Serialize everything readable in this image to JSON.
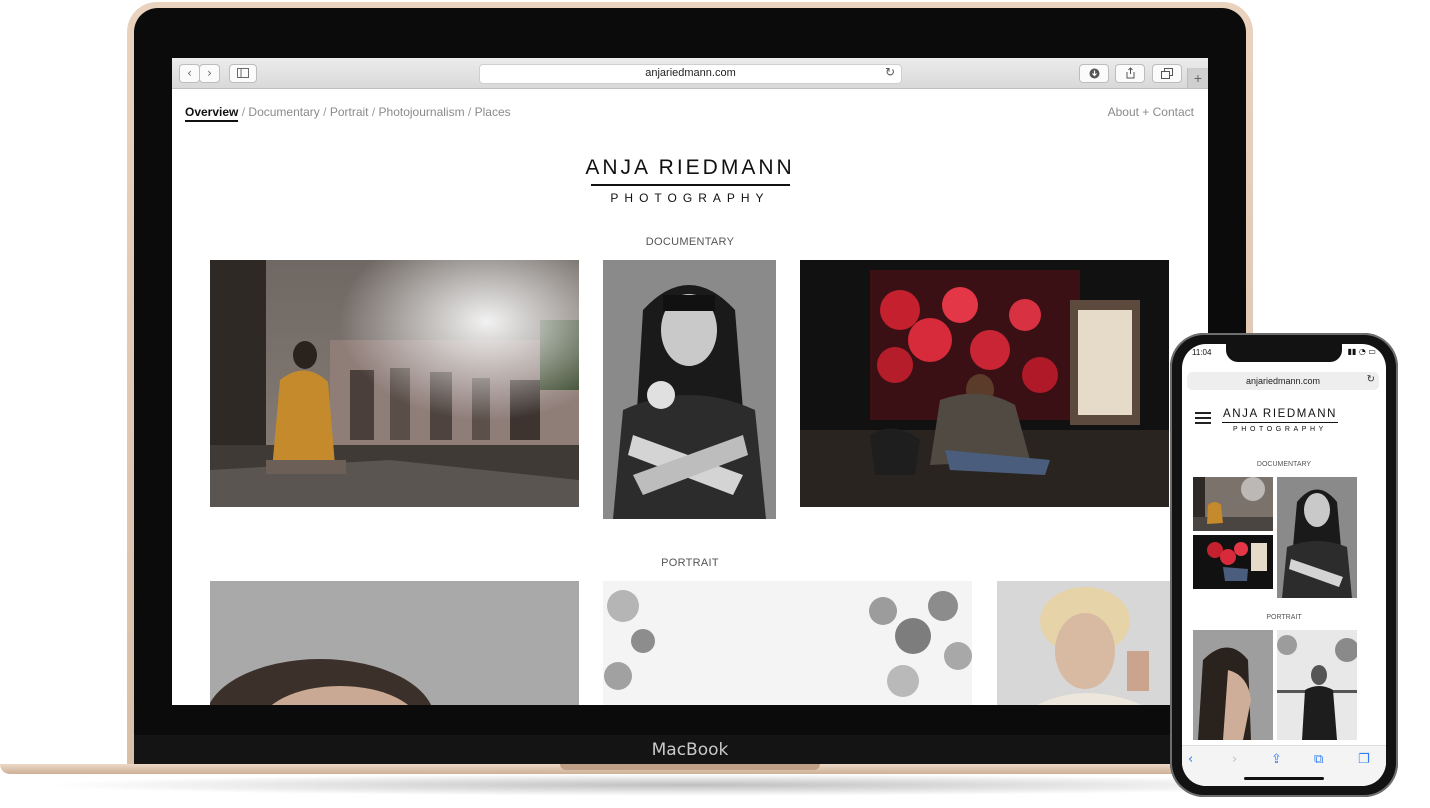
{
  "laptop": {
    "brand": "MacBook"
  },
  "browser": {
    "url": "anjariedmann.com",
    "icons": {
      "back": "chevron-left-icon",
      "forward": "chevron-right-icon",
      "sidebar": "sidebar-icon",
      "reload": "reload-icon",
      "download": "download-icon",
      "share": "share-icon",
      "tabs": "tabs-icon",
      "new_tab": "plus-icon"
    }
  },
  "site": {
    "nav": [
      {
        "label": "Overview",
        "active": true
      },
      {
        "label": "Documentary",
        "active": false
      },
      {
        "label": "Portrait",
        "active": false
      },
      {
        "label": "Photojournalism",
        "active": false
      },
      {
        "label": "Places",
        "active": false
      }
    ],
    "nav_separator": "/",
    "about": "About + Contact",
    "logo_name": "ANJA RIEDMANN",
    "logo_sub": "PHOTOGRAPHY",
    "sections": {
      "documentary": "DOCUMENTARY",
      "portrait": "PORTRAIT"
    }
  },
  "phone": {
    "time": "11:04",
    "url": "anjariedmann.com",
    "logo_name": "ANJA RIEDMANN",
    "logo_sub": "PHOTOGRAPHY",
    "sections": {
      "documentary": "DOCUMENTARY",
      "portrait": "PORTRAIT"
    }
  }
}
